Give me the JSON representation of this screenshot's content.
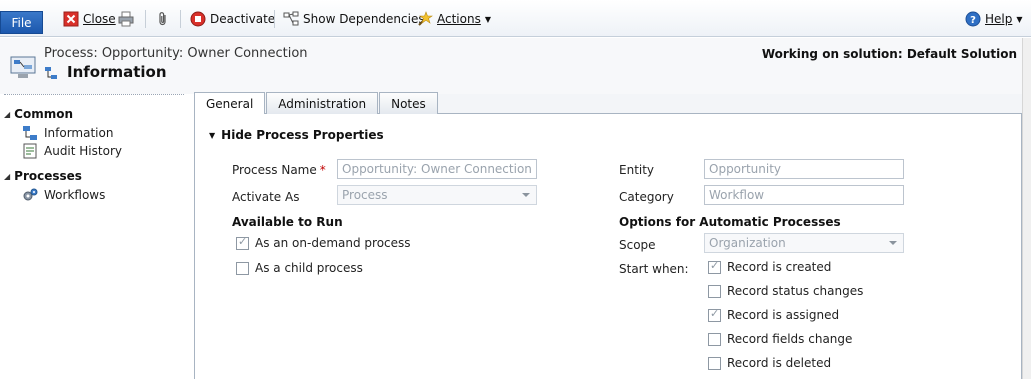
{
  "ribbon": {
    "file_label": "File",
    "close_label": "Close",
    "deactivate_label": "Deactivate",
    "show_dependencies_label": "Show Dependencies",
    "actions_label": "Actions",
    "help_label": "Help"
  },
  "header": {
    "process_label": "Process: Opportunity: Owner Connection",
    "title": "Information",
    "solution": "Working on solution: Default Solution"
  },
  "nav": {
    "groups": [
      {
        "label": "Common",
        "items": [
          {
            "label": "Information",
            "icon": "process-icon"
          },
          {
            "label": "Audit History",
            "icon": "audit-history-icon"
          }
        ]
      },
      {
        "label": "Processes",
        "items": [
          {
            "label": "Workflows",
            "icon": "workflow-gears-icon"
          }
        ]
      }
    ]
  },
  "tabs": [
    {
      "label": "General",
      "active": true
    },
    {
      "label": "Administration",
      "active": false
    },
    {
      "label": "Notes",
      "active": false
    }
  ],
  "form": {
    "section_title": "Hide Process Properties",
    "process_name_label": "Process Name",
    "process_name_required": "*",
    "process_name_value": "Opportunity: Owner Connection",
    "activate_as_label": "Activate As",
    "activate_as_value": "Process",
    "available_to_run_label": "Available to Run",
    "on_demand_label": "As an on-demand process",
    "on_demand_checked": true,
    "child_process_label": "As a child process",
    "child_process_checked": false,
    "entity_label": "Entity",
    "entity_value": "Opportunity",
    "category_label": "Category",
    "category_value": "Workflow",
    "options_label": "Options for Automatic Processes",
    "scope_label": "Scope",
    "scope_value": "Organization",
    "start_when_label": "Start when:",
    "start_when": [
      {
        "label": "Record is created",
        "checked": true
      },
      {
        "label": "Record status changes",
        "checked": false
      },
      {
        "label": "Record is assigned",
        "checked": true
      },
      {
        "label": "Record fields change",
        "checked": false
      },
      {
        "label": "Record is deleted",
        "checked": false
      }
    ]
  },
  "colors": {
    "file_button": "#1c58ad",
    "required_mark": "#c00000"
  }
}
